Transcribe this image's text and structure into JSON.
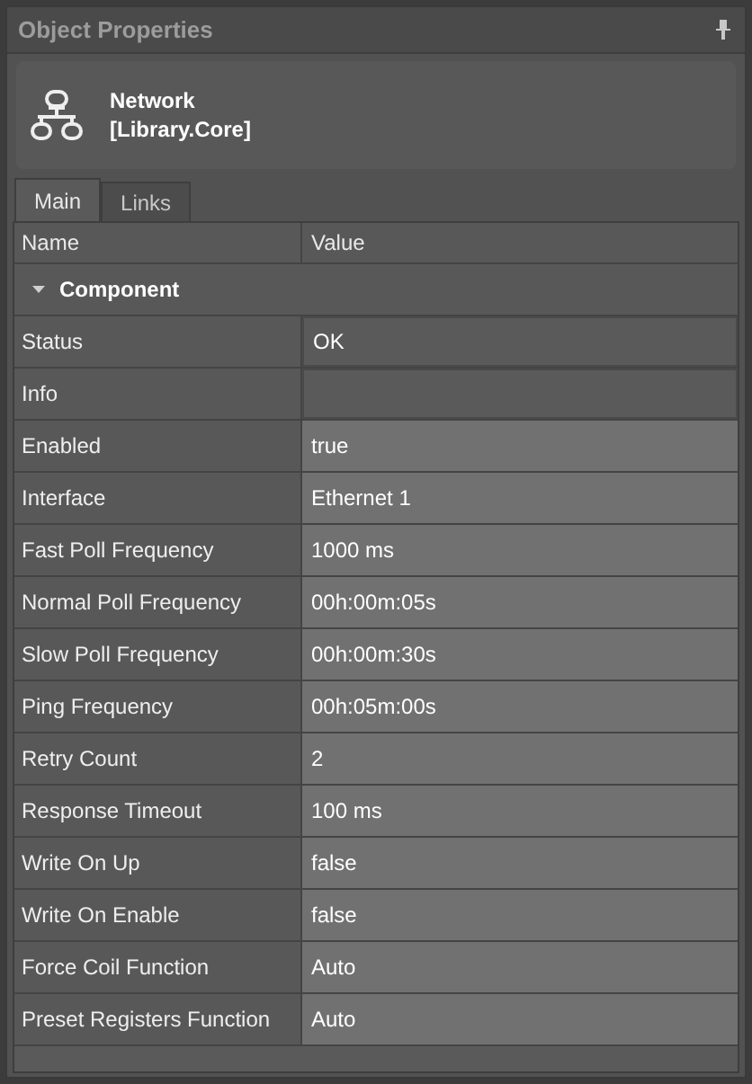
{
  "panel": {
    "title": "Object Properties"
  },
  "object": {
    "name": "Network",
    "library": "[Library.Core]"
  },
  "tabs": [
    {
      "label": "Main",
      "selected": true
    },
    {
      "label": "Links",
      "selected": false
    }
  ],
  "table": {
    "columns": [
      "Name",
      "Value"
    ],
    "group": {
      "label": "Component",
      "expanded": true
    },
    "rows": [
      {
        "name": "Status",
        "value": "OK",
        "editable": false
      },
      {
        "name": "Info",
        "value": "",
        "editable": false
      },
      {
        "name": "Enabled",
        "value": "true",
        "editable": true
      },
      {
        "name": "Interface",
        "value": "Ethernet 1",
        "editable": true
      },
      {
        "name": "Fast Poll Frequency",
        "value": "1000 ms",
        "editable": true
      },
      {
        "name": "Normal Poll Frequency",
        "value": "00h:00m:05s",
        "editable": true
      },
      {
        "name": "Slow Poll Frequency",
        "value": "00h:00m:30s",
        "editable": true
      },
      {
        "name": "Ping Frequency",
        "value": "00h:05m:00s",
        "editable": true
      },
      {
        "name": "Retry Count",
        "value": "2",
        "editable": true
      },
      {
        "name": "Response Timeout",
        "value": "100 ms",
        "editable": true
      },
      {
        "name": "Write On Up",
        "value": "false",
        "editable": true
      },
      {
        "name": "Write On Enable",
        "value": "false",
        "editable": true
      },
      {
        "name": "Force Coil Function",
        "value": "Auto",
        "editable": true
      },
      {
        "name": "Preset Registers Function",
        "value": "Auto",
        "editable": true
      }
    ]
  }
}
